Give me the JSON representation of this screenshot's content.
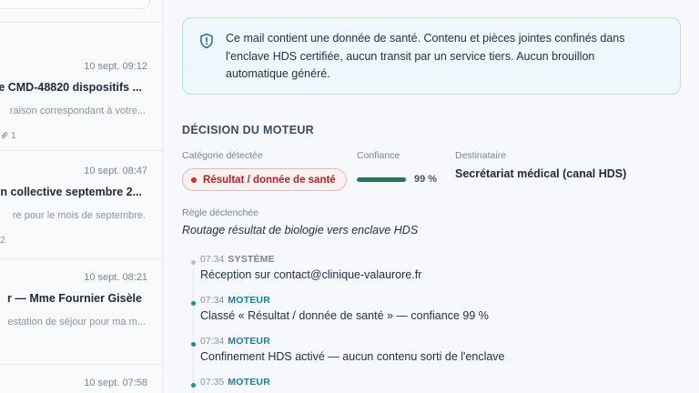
{
  "mail_list": {
    "items": [
      {
        "date": "10 sept. 09:12",
        "subject": "e CMD-48820 dispositifs ...",
        "preview": "raison correspondant à votre...",
        "attachments": "1"
      },
      {
        "date": "10 sept. 08:47",
        "subject": "on collective septembre 2...",
        "preview": "re pour le mois de septembre.",
        "attachments": "2"
      },
      {
        "date": "10 sept. 08:21",
        "subject": "r — Mme Fournier Gisèle",
        "preview": "estation de séjour pour ma m...",
        "attachments": ""
      },
      {
        "date": "10 sept. 07:58",
        "subject": "",
        "preview": "",
        "attachments": ""
      }
    ]
  },
  "detail": {
    "banner": {
      "icon": "shield-icon",
      "text": "Ce mail contient une donnée de santé. Contenu et pièces jointes confinés dans l'enclave HDS certifiée, aucun transit par un service tiers. Aucun brouillon automatique généré."
    },
    "decision": {
      "title": "DÉCISION DU MOTEUR",
      "category_label": "Catégorie détectée",
      "category_value": "Résultat / donnée de santé",
      "category_color": "#d92d2d",
      "confidence_label": "Confiance",
      "confidence_value": 0.99,
      "confidence_text": "99 %",
      "recipient_label": "Destinataire",
      "recipient_value": "Secrétariat médical (canal HDS)",
      "rule_label": "Règle déclenchée",
      "rule_value": "Routage résultat de biologie vers enclave HDS"
    },
    "timeline": [
      {
        "time": "07:34",
        "actor": "SYSTÈME",
        "text": "Réception sur contact@clinique-valaurore.fr"
      },
      {
        "time": "07:34",
        "actor": "MOTEUR",
        "text": "Classé « Résultat / donnée de santé » — confiance 99 %"
      },
      {
        "time": "07:34",
        "actor": "MOTEUR",
        "text": "Confinement HDS activé — aucun contenu sorti de l'enclave"
      },
      {
        "time": "07:35",
        "actor": "MOTEUR",
        "text": ""
      }
    ]
  },
  "colors": {
    "accent": "#1c7fa0",
    "health_red": "#b4232a",
    "confidence_green": "#1f7a5a",
    "banner_bg": "#eef7fc"
  }
}
